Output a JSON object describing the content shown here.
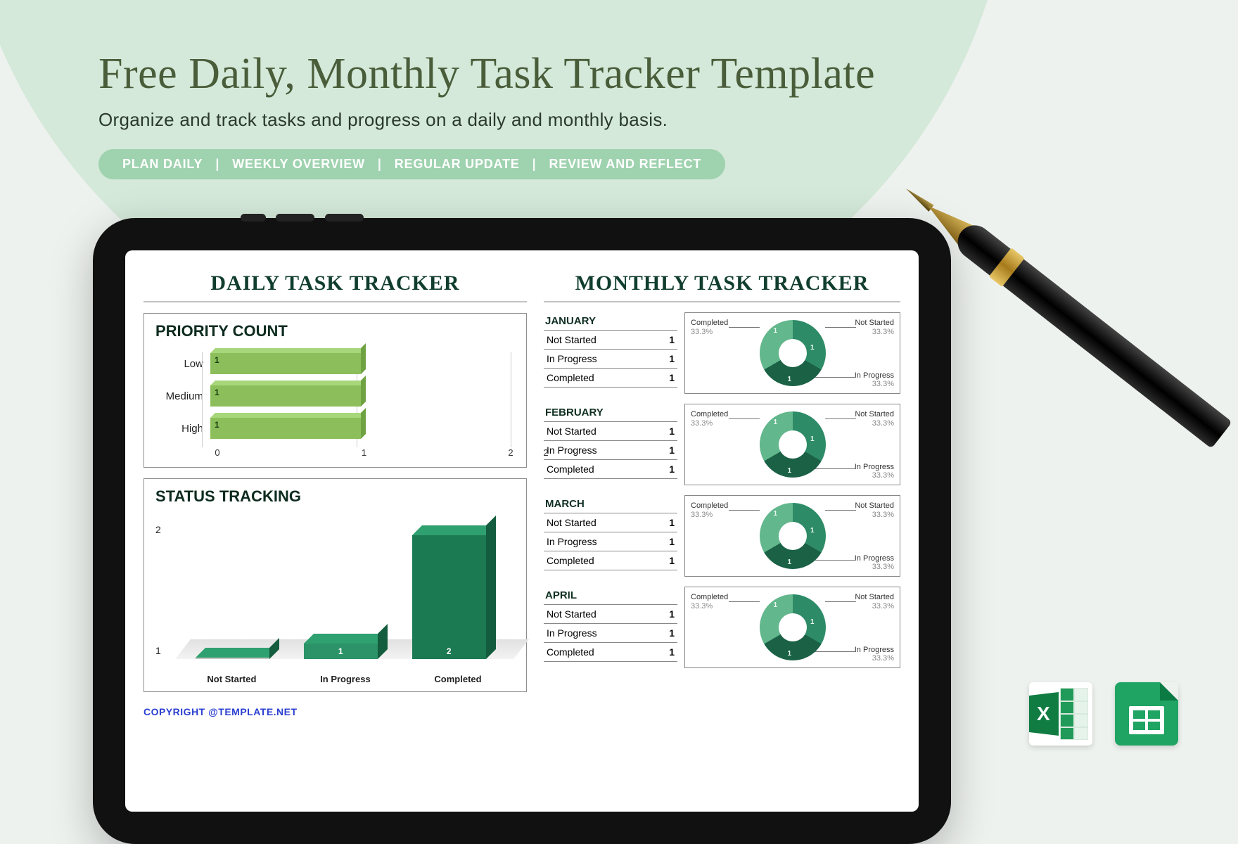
{
  "header": {
    "title": "Free Daily, Monthly Task Tracker Template",
    "subtitle": "Organize and track tasks and progress on a daily and monthly basis.",
    "pills": [
      "PLAN DAILY",
      "WEEKLY OVERVIEW",
      "REGULAR UPDATE",
      "REVIEW AND REFLECT"
    ]
  },
  "daily": {
    "title": "DAILY TASK TRACKER",
    "priority": {
      "title": "PRIORITY COUNT",
      "axis": [
        "0",
        "1",
        "2",
        "2"
      ],
      "rows": [
        {
          "label": "Low",
          "value": "1"
        },
        {
          "label": "Medium",
          "value": "1"
        },
        {
          "label": "High",
          "value": "1"
        }
      ]
    },
    "status": {
      "title": "STATUS TRACKING",
      "yticks": [
        "2",
        "1"
      ],
      "bars": [
        {
          "label": "Not Started",
          "value": ""
        },
        {
          "label": "In Progress",
          "value": "1"
        },
        {
          "label": "Completed",
          "value": "2"
        }
      ]
    },
    "copyright": "COPYRIGHT @TEMPLATE.NET"
  },
  "monthly": {
    "title": "MONTHLY TASK TRACKER",
    "donut_labels": {
      "completed": "Completed",
      "not_started": "Not Started",
      "in_progress": "In Progress",
      "pct": "33.3%"
    },
    "months": [
      {
        "name": "JANUARY",
        "rows": [
          {
            "k": "Not Started",
            "v": "1"
          },
          {
            "k": "In Progress",
            "v": "1"
          },
          {
            "k": "Completed",
            "v": "1"
          }
        ]
      },
      {
        "name": "FEBRUARY",
        "rows": [
          {
            "k": "Not Started",
            "v": "1"
          },
          {
            "k": "In Progress",
            "v": "1"
          },
          {
            "k": "Completed",
            "v": "1"
          }
        ]
      },
      {
        "name": "MARCH",
        "rows": [
          {
            "k": "Not Started",
            "v": "1"
          },
          {
            "k": "In Progress",
            "v": "1"
          },
          {
            "k": "Completed",
            "v": "1"
          }
        ]
      },
      {
        "name": "APRIL",
        "rows": [
          {
            "k": "Not Started",
            "v": "1"
          },
          {
            "k": "In Progress",
            "v": "1"
          },
          {
            "k": "Completed",
            "v": "1"
          }
        ]
      }
    ]
  },
  "chart_data": [
    {
      "type": "bar",
      "orientation": "horizontal",
      "title": "PRIORITY COUNT",
      "categories": [
        "Low",
        "Medium",
        "High"
      ],
      "values": [
        1,
        1,
        1
      ],
      "xlim": [
        0,
        2
      ]
    },
    {
      "type": "bar",
      "title": "STATUS TRACKING",
      "categories": [
        "Not Started",
        "In Progress",
        "Completed"
      ],
      "values": [
        0,
        1,
        2
      ],
      "ylim": [
        0,
        2
      ]
    },
    {
      "type": "pie",
      "title": "JANUARY",
      "series": [
        {
          "name": "Completed",
          "value": 33.3
        },
        {
          "name": "Not Started",
          "value": 33.3
        },
        {
          "name": "In Progress",
          "value": 33.3
        }
      ]
    },
    {
      "type": "pie",
      "title": "FEBRUARY",
      "series": [
        {
          "name": "Completed",
          "value": 33.3
        },
        {
          "name": "Not Started",
          "value": 33.3
        },
        {
          "name": "In Progress",
          "value": 33.3
        }
      ]
    },
    {
      "type": "pie",
      "title": "MARCH",
      "series": [
        {
          "name": "Completed",
          "value": 33.3
        },
        {
          "name": "Not Started",
          "value": 33.3
        },
        {
          "name": "In Progress",
          "value": 33.3
        }
      ]
    },
    {
      "type": "pie",
      "title": "APRIL",
      "series": [
        {
          "name": "Completed",
          "value": 33.3
        },
        {
          "name": "Not Started",
          "value": 33.3
        },
        {
          "name": "In Progress",
          "value": 33.3
        }
      ]
    }
  ]
}
